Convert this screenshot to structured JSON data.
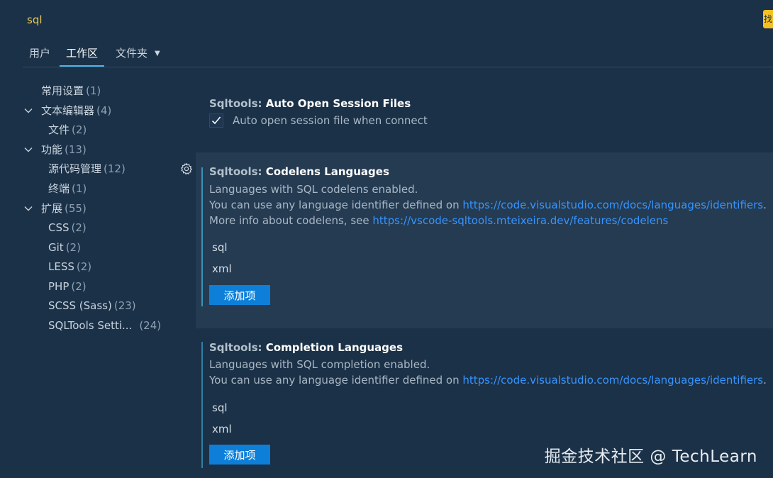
{
  "search": {
    "value": "sql",
    "badge": "找"
  },
  "tabs": [
    {
      "label": "用户"
    },
    {
      "label": "工作区"
    },
    {
      "label": "文件夹"
    }
  ],
  "toc": [
    {
      "label": "常用设置",
      "count": "(1)"
    },
    {
      "label": "文本编辑器",
      "count": "(4)"
    },
    {
      "label": "文件",
      "count": "(2)"
    },
    {
      "label": "功能",
      "count": "(13)"
    },
    {
      "label": "源代码管理",
      "count": "(12)"
    },
    {
      "label": "终端",
      "count": "(1)"
    },
    {
      "label": "扩展",
      "count": "(55)"
    },
    {
      "label": "CSS",
      "count": "(2)"
    },
    {
      "label": "Git",
      "count": "(2)"
    },
    {
      "label": "LESS",
      "count": "(2)"
    },
    {
      "label": "PHP",
      "count": "(2)"
    },
    {
      "label": "SCSS (Sass)",
      "count": "(23)"
    },
    {
      "label": "SQLTools Setti...",
      "count": "(24)"
    }
  ],
  "settings": {
    "auto_open": {
      "category": "Sqltools: ",
      "title": "Auto Open Session Files",
      "checkbox_label": "Auto open session file when connect",
      "checked": true
    },
    "codelens": {
      "category": "Sqltools: ",
      "title": "Codelens Languages",
      "desc1": "Languages with SQL codelens enabled.",
      "desc2_prefix": "You can use any language identifier defined on ",
      "desc2_link": "https://code.visualstudio.com/docs/languages/identifiers",
      "desc2_suffix": ".",
      "desc3_prefix": "More info about codelens, see ",
      "desc3_link": "https://vscode-sqltools.mteixeira.dev/features/codelens",
      "items": [
        "sql",
        "xml"
      ],
      "add_label": "添加项"
    },
    "completion": {
      "category": "Sqltools: ",
      "title": "Completion Languages",
      "desc1": "Languages with SQL completion enabled.",
      "desc2_prefix": "You can use any language identifier defined on ",
      "desc2_link": "https://code.visualstudio.com/docs/languages/identifiers",
      "desc2_suffix": ".",
      "items": [
        "sql",
        "xml"
      ],
      "add_label": "添加项"
    }
  },
  "watermark": "掘金技术社区 @ TechLearn",
  "icons": {
    "gear": "gear-icon",
    "chevron": "chevron-down-icon",
    "check": "check-icon",
    "caret": "caret-down-icon"
  }
}
